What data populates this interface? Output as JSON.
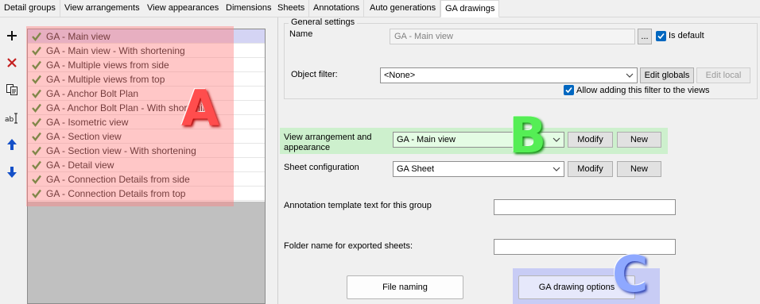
{
  "tabs": [
    {
      "label": "Detail groups"
    },
    {
      "label": "View arrangements"
    },
    {
      "label": "View appearances"
    },
    {
      "label": "Dimensions"
    },
    {
      "label": "Sheets"
    },
    {
      "label": "Annotations"
    },
    {
      "label": "Auto generations"
    },
    {
      "label": "GA drawings",
      "active": true
    }
  ],
  "toolbar": {
    "add_icon": "plus-icon",
    "delete_icon": "red-x-icon",
    "copy_icon": "copy-icon",
    "rename_icon": "rename-icon",
    "move_up_icon": "arrow-up-icon",
    "move_down_icon": "arrow-down-icon"
  },
  "list": {
    "items": [
      {
        "label": "GA - Main view",
        "checked": true,
        "selected": true
      },
      {
        "label": "GA - Main view - With shortening",
        "checked": true
      },
      {
        "label": "GA - Multiple views from side",
        "checked": true
      },
      {
        "label": "GA - Multiple views from top",
        "checked": true
      },
      {
        "label": "GA - Anchor Bolt Plan",
        "checked": true
      },
      {
        "label": "GA - Anchor Bolt Plan - With shortening",
        "checked": true
      },
      {
        "label": "GA - Isometric view",
        "checked": true
      },
      {
        "label": "GA - Section view",
        "checked": true
      },
      {
        "label": "GA - Section view - With shortening",
        "checked": true
      },
      {
        "label": "GA - Detail view",
        "checked": true
      },
      {
        "label": "GA - Connection Details from side",
        "checked": true
      },
      {
        "label": "GA - Connection Details from top",
        "checked": true
      }
    ]
  },
  "general_settings": {
    "title": "General settings",
    "name_label": "Name",
    "name_value": "GA - Main view",
    "browse_label": "...",
    "is_default_label": "Is default",
    "is_default_checked": true,
    "object_filter_label": "Object filter:",
    "object_filter_value": "<None>",
    "edit_globals_label": "Edit globals",
    "edit_local_label": "Edit local",
    "allow_filter_label": "Allow adding this filter to the views",
    "allow_filter_checked": true
  },
  "view_arrangement": {
    "label": "View arrangement and appearance",
    "value": "GA - Main view",
    "modify_label": "Modify",
    "new_label": "New"
  },
  "sheet_configuration": {
    "label": "Sheet configuration",
    "value": "GA Sheet",
    "modify_label": "Modify",
    "new_label": "New"
  },
  "annotation_template": {
    "label": "Annotation template text for this group",
    "value": ""
  },
  "folder_name": {
    "label": "Folder name for exported sheets:",
    "value": ""
  },
  "buttons": {
    "file_naming": "File naming",
    "ga_drawing_options": "GA drawing options"
  },
  "annotations": {
    "a": "A",
    "b": "B",
    "c": "C"
  },
  "colors": {
    "overlay_a": "#ff8282",
    "overlay_b": "#8cf08c",
    "overlay_c": "#96a0fa",
    "checkbox_blue": "#0067c0",
    "check_green": "#1a8a1a"
  }
}
